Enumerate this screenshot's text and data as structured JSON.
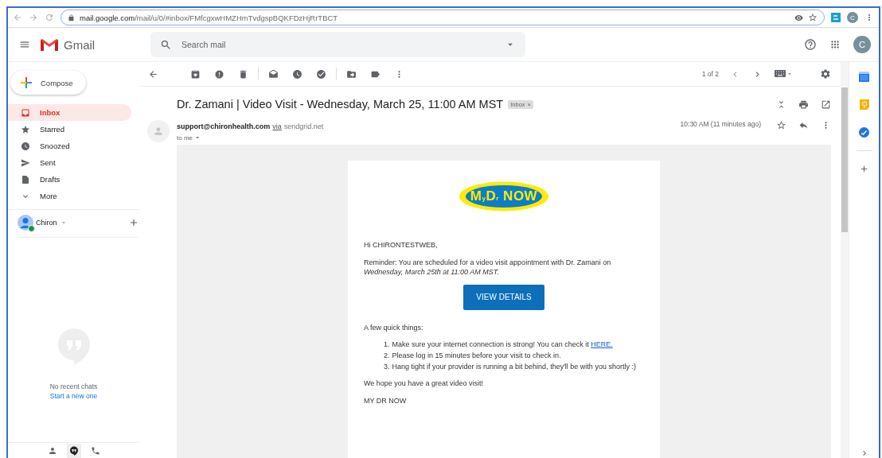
{
  "browser": {
    "url_host": "mail.google.com",
    "url_path": "/mail/u/0/#inbox/FMfcgxwHMZHmTvdgspBQKFDzHjRrTBCT",
    "profile_initial": "C"
  },
  "app": {
    "name": "Gmail",
    "account_initial": "C"
  },
  "search": {
    "placeholder": "Search mail"
  },
  "compose": {
    "label": "Compose"
  },
  "sidebar": {
    "items": [
      {
        "label": "Inbox",
        "kind": "inbox",
        "selected": true
      },
      {
        "label": "Starred",
        "kind": "star",
        "selected": false
      },
      {
        "label": "Snoozed",
        "kind": "clock",
        "selected": false
      },
      {
        "label": "Sent",
        "kind": "send",
        "selected": false
      },
      {
        "label": "Drafts",
        "kind": "file",
        "selected": false
      },
      {
        "label": "More",
        "kind": "chevron",
        "selected": false
      }
    ]
  },
  "chat": {
    "user": "Chiron",
    "online": true,
    "empty_text": "No recent chats",
    "link": "Start a new one"
  },
  "toolbar": {
    "pager": "1 of 2"
  },
  "message": {
    "subject": "Dr. Zamani | Video Visit - Wednesday, March 25, 11:00 AM MST",
    "label_chip": "Inbox",
    "chip_close": "×",
    "sender": "support@chironhealth.com",
    "via": "via",
    "via_domain": "sendgrid.net",
    "recipient": "to me",
    "time": "10:30 AM (11 minutes ago)",
    "starred": false
  },
  "email": {
    "logo": "M$_{y}$D$_{r}$ NOW",
    "greeting": "Hi CHIRONTESTWEB,",
    "reminder": "Reminder: You are scheduled for a video visit appointment with Dr. Zamani on *Wednesday, March 25th at 11:00 AM MST.*",
    "button": "VIEW DETAILS",
    "intro": "A few quick things:",
    "items": [
      {
        "number": "1.",
        "text": "Make sure your internet connection is strong! You can check it ",
        "link": "HERE."
      },
      {
        "number": "2.",
        "text": "Please log in 15 minutes before your visit to check in."
      },
      {
        "number": "3.",
        "text": "Hang tight if your provider is running a bit behind, they'll be with you shortly :)"
      }
    ],
    "closing": "We hope you have a great video visit!",
    "signature": "MY DR NOW"
  }
}
